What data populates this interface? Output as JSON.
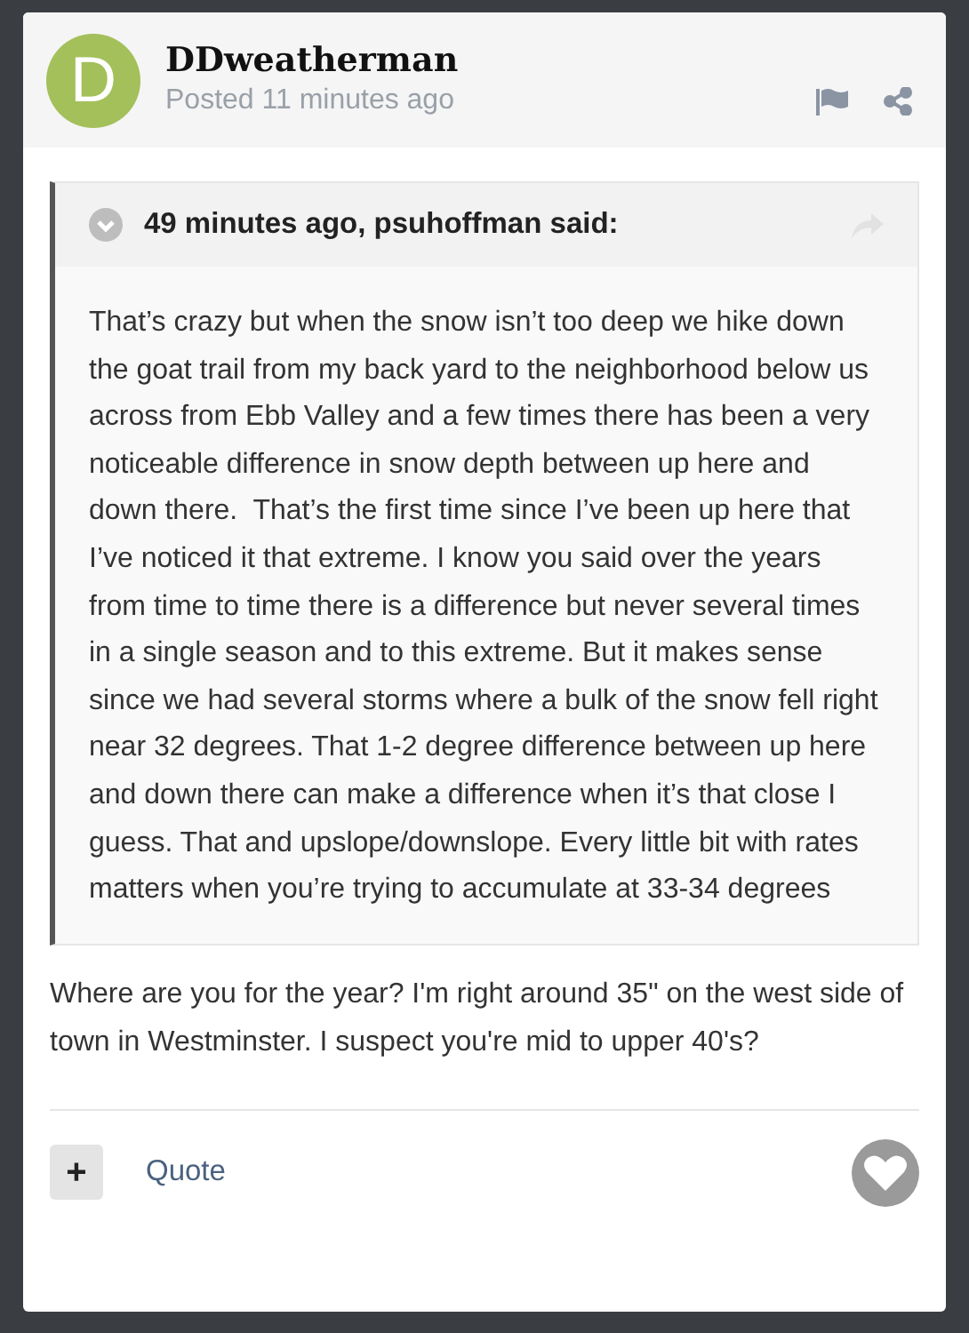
{
  "post": {
    "avatar_letter": "D",
    "author": "DDweatherman",
    "posted": "Posted 11 minutes ago"
  },
  "quote": {
    "header": "49 minutes ago, psuhoffman said:",
    "text": "That’s crazy but when the snow isn’t too deep we hike down the goat trail from my back yard to the neighborhood below us across from Ebb Valley and a few times there has been a very noticeable difference in snow depth between up here and down there.  That’s the first time since I’ve been up here that I’ve noticed it that extreme. I know you said over the years from time to time there is a difference but never several times in a single season and to this extreme. But it makes sense since we had several storms where a bulk of the snow fell right near 32 degrees. That 1-2 degree difference between up here and down there can make a difference when it’s that close I guess. That and upslope/downslope. Every little bit with rates matters when you’re trying to accumulate at 33-34 degrees"
  },
  "reply": "Where are you for the year? I'm right around 35\" on the west side of town in Westminster. I suspect you're mid to upper 40's?",
  "footer": {
    "multiquote": "+",
    "quote_link": "Quote"
  }
}
